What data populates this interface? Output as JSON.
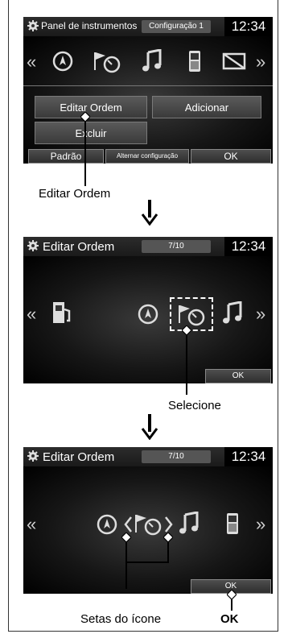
{
  "panel1": {
    "title": "Panel de instrumentos",
    "config": "Configuração 1",
    "clock": "12:34",
    "buttons": {
      "edit": "Editar Ordem",
      "add": "Adicionar",
      "delete": "Excluir"
    },
    "bottom": {
      "default": "Padrão",
      "switch": "Alternar configuração",
      "ok": "OK"
    },
    "icons": [
      "compass-icon",
      "speedometer-flag-icon",
      "music-note-icon",
      "phone-icon",
      "no-display-icon"
    ]
  },
  "caption1": "Editar Ordem",
  "panel2": {
    "title": "Editar Ordem",
    "counter": "7/10",
    "clock": "12:34",
    "ok": "OK",
    "icons": [
      "fuel-icon",
      "compass-icon",
      "speedometer-flag-icon",
      "music-note-icon"
    ]
  },
  "caption2": "Selecione",
  "panel3": {
    "title": "Editar Ordem",
    "counter": "7/10",
    "clock": "12:34",
    "ok": "OK",
    "icons": [
      "compass-icon",
      "speedometer-flag-icon",
      "music-note-icon",
      "phone-icon"
    ]
  },
  "caption3a": "Setas do ícone",
  "caption3b": "OK"
}
